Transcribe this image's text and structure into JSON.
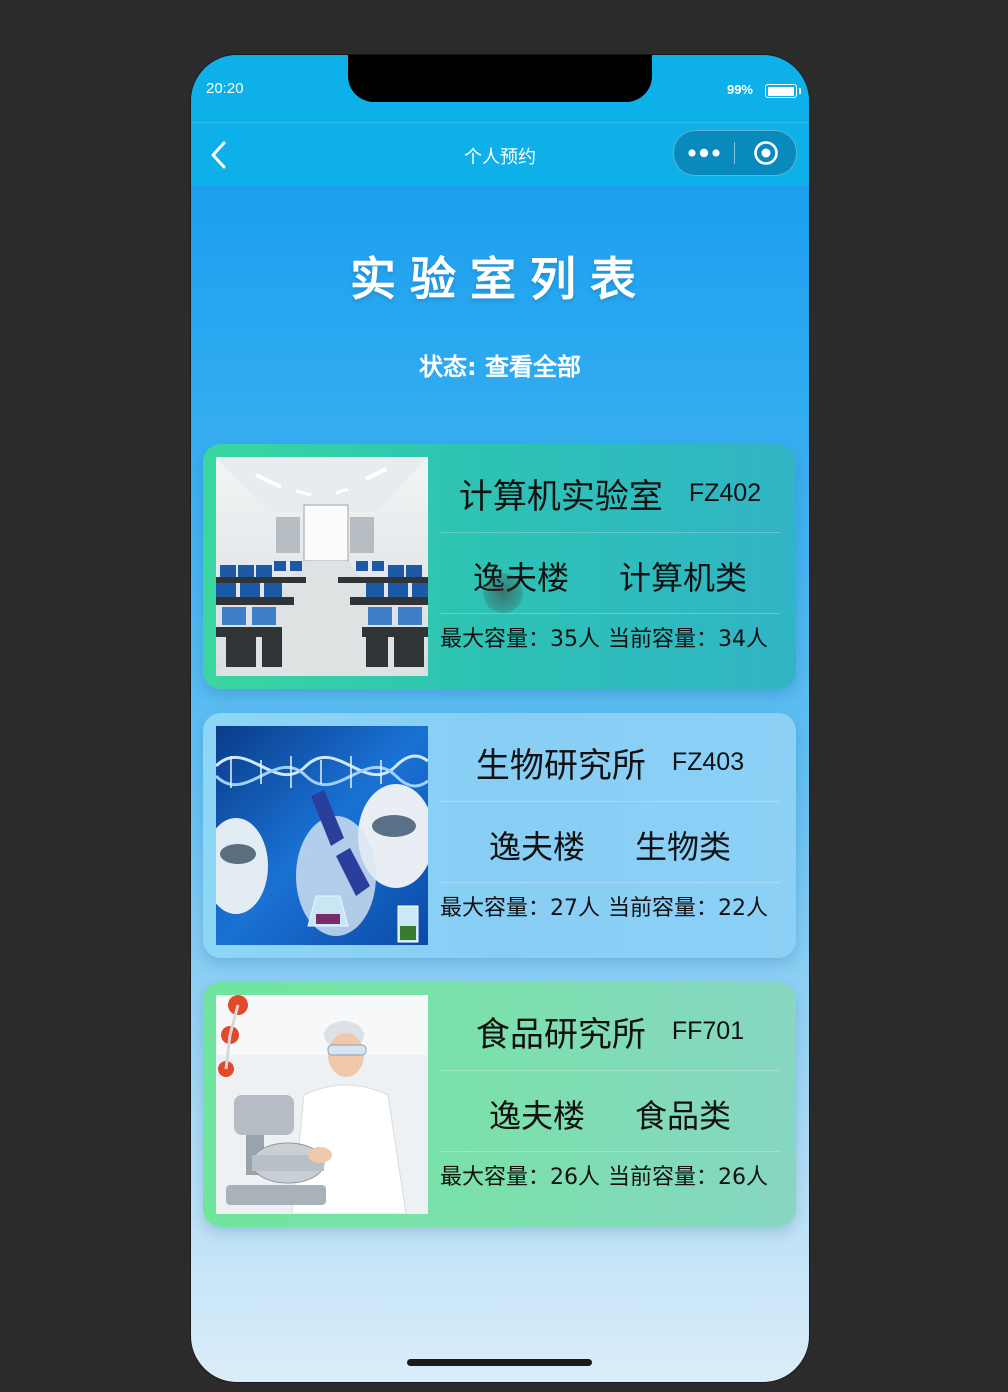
{
  "status_bar": {
    "time": "20:20",
    "battery": "99%"
  },
  "nav": {
    "title": "个人预约"
  },
  "page": {
    "heading": "实验室列表",
    "status_label": "状态:",
    "status_value": "查看全部"
  },
  "labs": [
    {
      "name": "计算机实验室",
      "code": "FZ402",
      "building": "逸夫楼",
      "category": "计算机类",
      "max_capacity": "最大容量：35人",
      "current_capacity": "当前容量：34人"
    },
    {
      "name": "生物研究所",
      "code": "FZ403",
      "building": "逸夫楼",
      "category": "生物类",
      "max_capacity": "最大容量：27人",
      "current_capacity": "当前容量：22人"
    },
    {
      "name": "食品研究所",
      "code": "FF701",
      "building": "逸夫楼",
      "category": "食品类",
      "max_capacity": "最大容量：26人",
      "current_capacity": "当前容量：26人"
    }
  ],
  "icons": {
    "back": "chevron-left-icon",
    "more": "more-dots-icon",
    "close": "target-close-icon",
    "battery": "battery-icon"
  },
  "colors": {
    "nav_bg": "#0db0e8",
    "page_top": "#1398ee",
    "page_bottom": "#dcedf9",
    "card_computer": "#2ec3b3",
    "card_bio": "#8ed6f5",
    "card_food": "#7ce0ad"
  }
}
